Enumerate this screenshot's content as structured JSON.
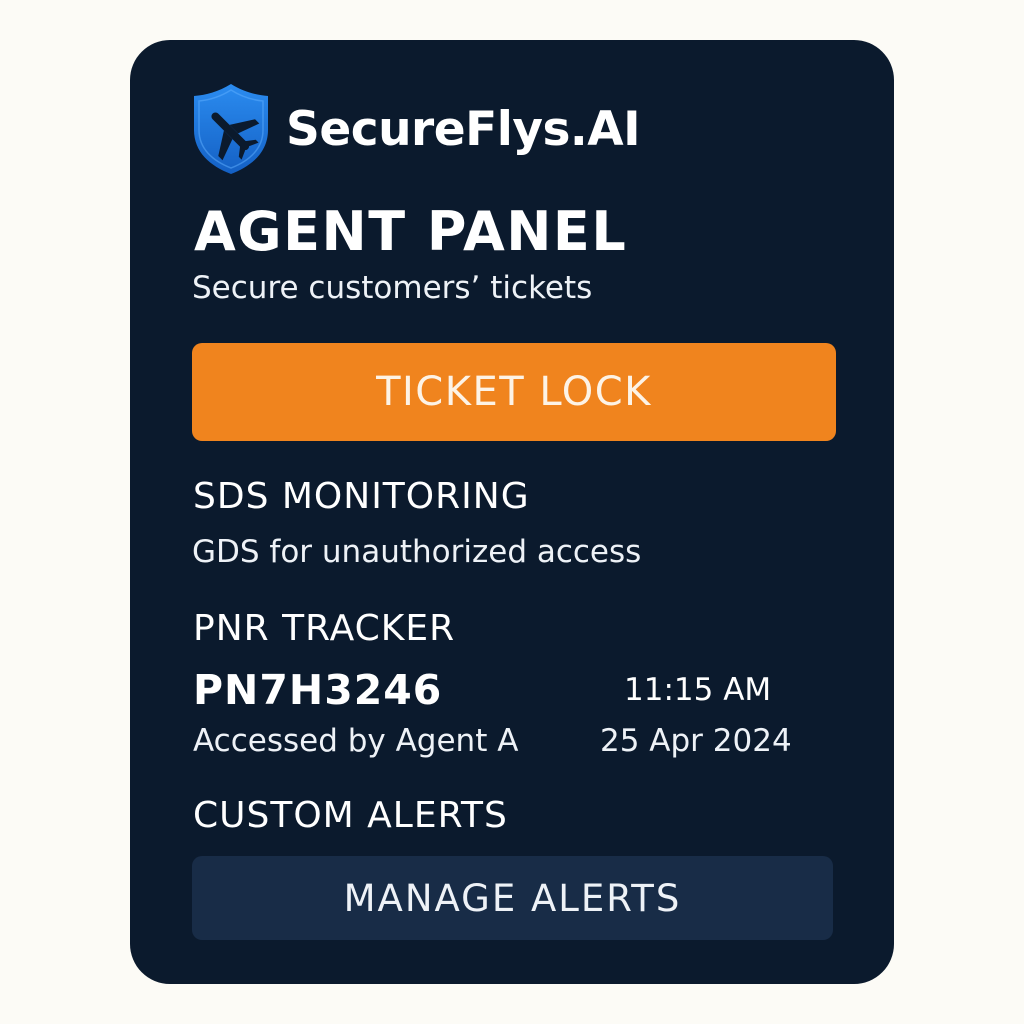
{
  "brand": {
    "name": "SecureFlys.AI",
    "logo_icon": "shield-plane-icon",
    "logo_color": "#1e7ee0"
  },
  "panel": {
    "title": "AGENT PANEL",
    "subtitle": "Secure customers’ tickets",
    "background_color": "#0b1a2d"
  },
  "ticket_lock": {
    "label": "TICKET LOCK",
    "color": "#f0841e"
  },
  "sds_monitoring": {
    "heading": "SDS MONITORING",
    "description": "GDS for unauthorized access"
  },
  "pnr_tracker": {
    "heading": "PNR TRACKER",
    "pnr_code": "PN7H3246",
    "time": "11:15 AM",
    "accessed_by": "Accessed by Agent A",
    "date": "25 Apr 2024"
  },
  "custom_alerts": {
    "heading": "CUSTOM ALERTS",
    "button_label": "MANAGE ALERTS",
    "button_color": "#182c47"
  }
}
